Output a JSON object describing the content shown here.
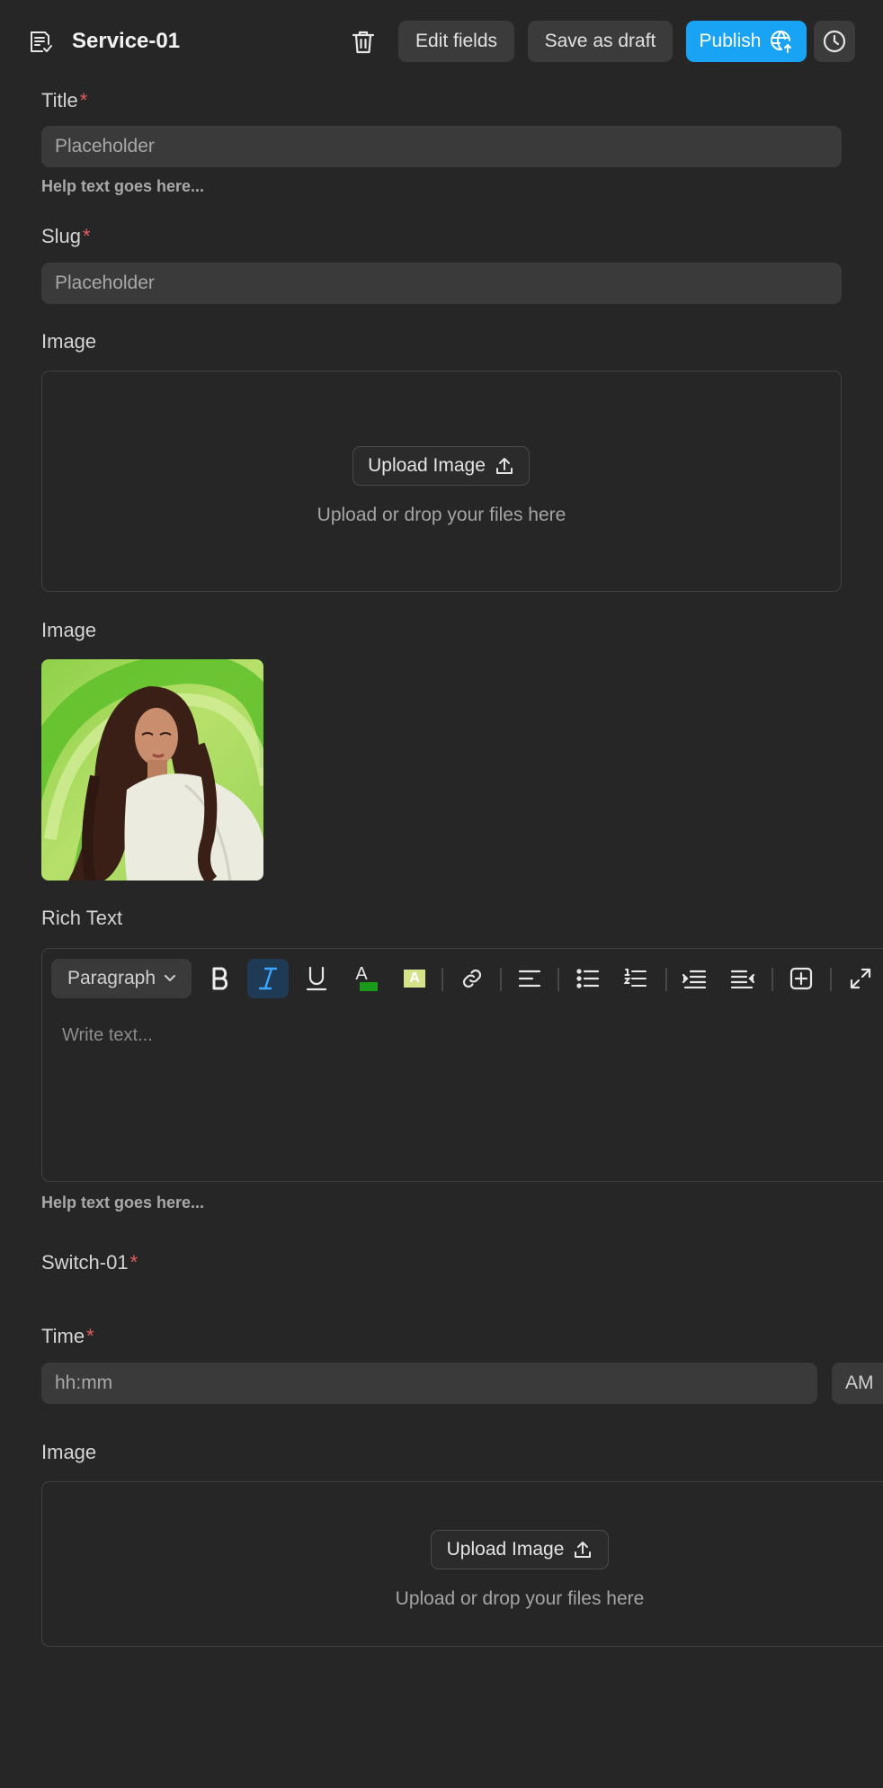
{
  "header": {
    "title": "Service-01",
    "edit_label": "Edit fields",
    "draft_label": "Save as draft",
    "publish_label": "Publish"
  },
  "fields": {
    "title": {
      "label": "Title",
      "required": "*",
      "placeholder": "Placeholder",
      "help": "Help text goes here..."
    },
    "slug": {
      "label": "Slug",
      "required": "*",
      "placeholder": "Placeholder"
    },
    "image1": {
      "label": "Image",
      "upload_label": "Upload Image",
      "hint": "Upload or drop your files here"
    },
    "image2": {
      "label": "Image"
    },
    "rich_text": {
      "label": "Rich Text",
      "block_type": "Paragraph",
      "placeholder": "Write text...",
      "help": "Help text goes here...",
      "tools": [
        "bold-icon",
        "italic-icon",
        "underline-icon",
        "text-color-icon",
        "highlight-icon",
        "link-icon",
        "align-left-icon",
        "bullet-list-icon",
        "numbered-list-icon",
        "outdent-icon",
        "indent-icon",
        "insert-icon",
        "expand-icon"
      ],
      "active_tool": "italic-icon",
      "text_color_letter": "A",
      "highlight_letter": "A"
    },
    "switch": {
      "label": "Switch-01",
      "required": "*"
    },
    "time": {
      "label": "Time",
      "required": "*",
      "placeholder": "hh:mm",
      "period": "AM"
    },
    "image3": {
      "label": "Image",
      "upload_label": "Upload Image",
      "hint": "Upload or drop your files here"
    }
  },
  "colors": {
    "background": "#262626",
    "accent": "#19a3f5",
    "required": "#e35d5d",
    "text_color_swatch": "#1a9a1a",
    "highlight_swatch": "#d6e38a"
  }
}
